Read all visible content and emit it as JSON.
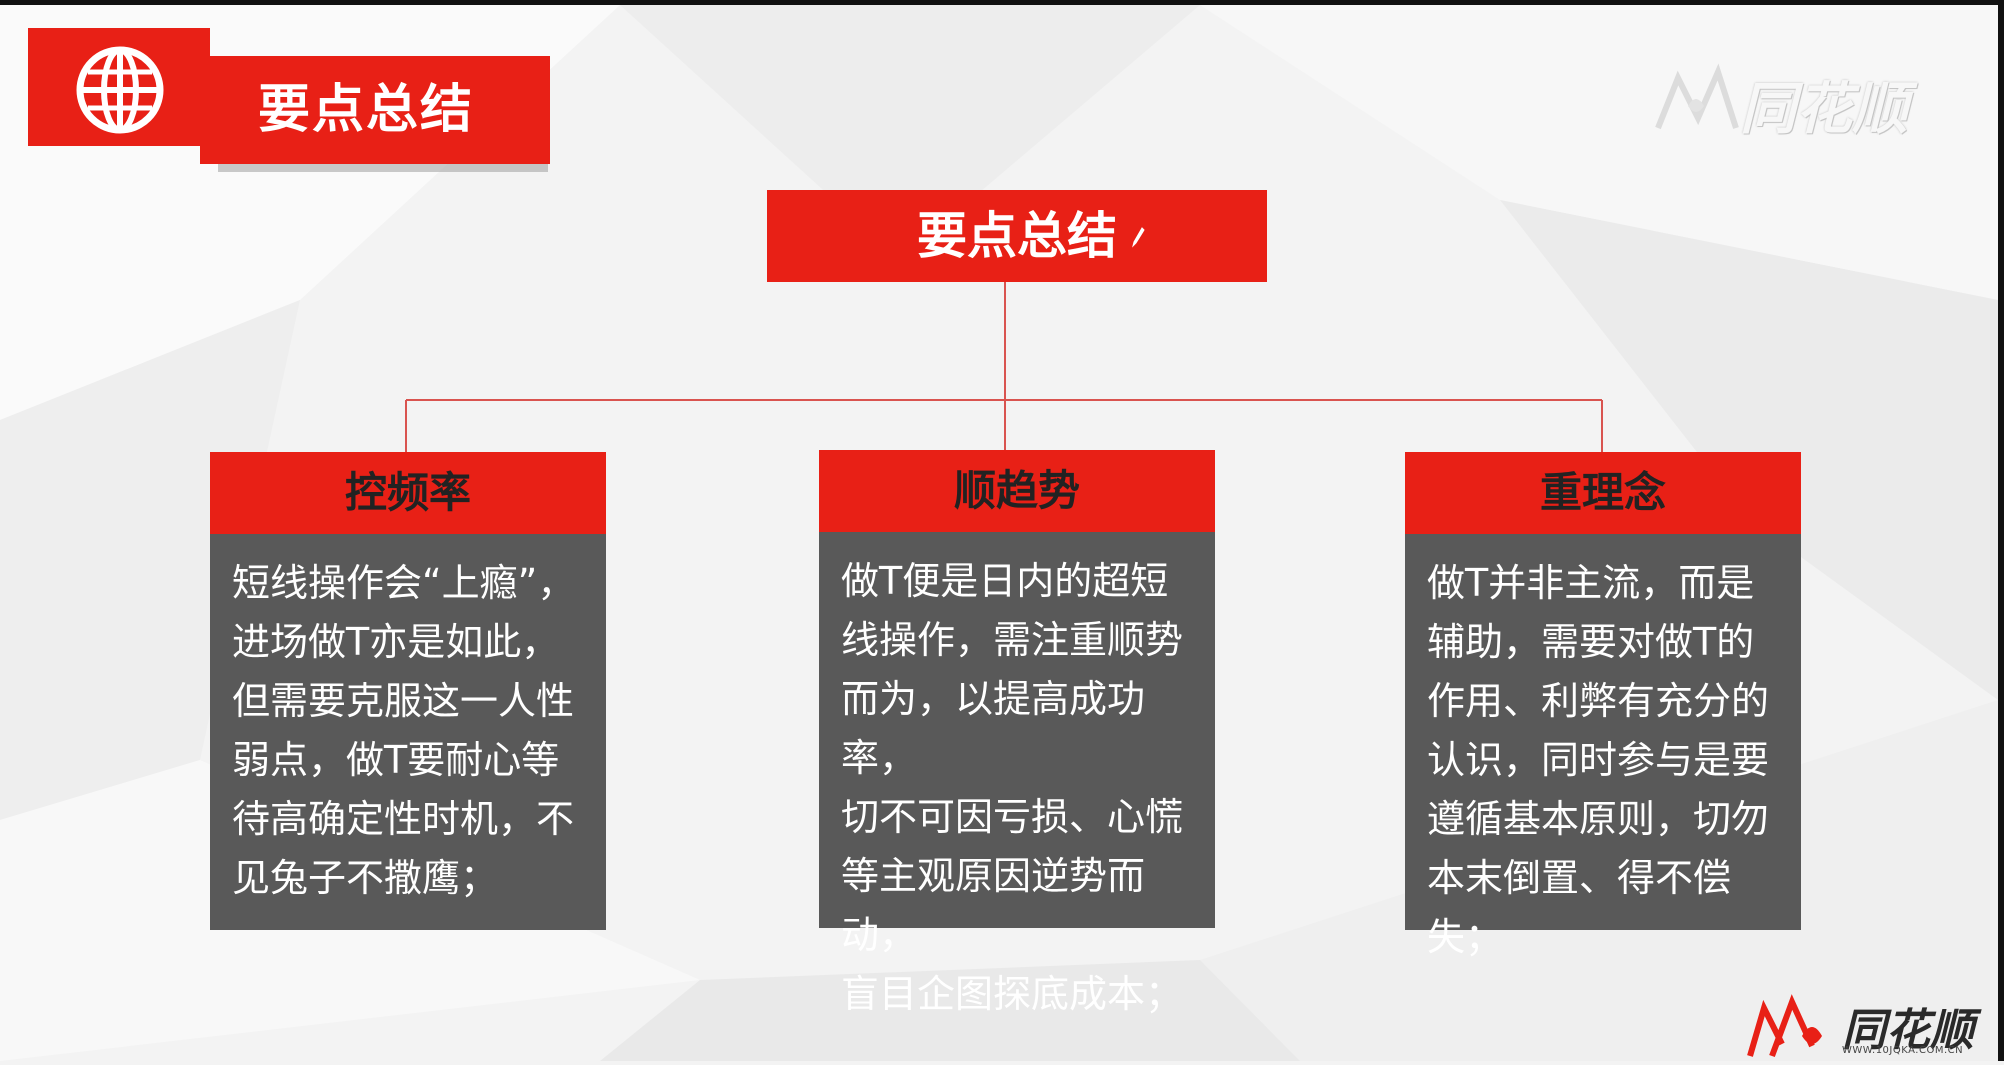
{
  "header": {
    "title": "要点总结"
  },
  "watermark": {
    "text": "同花顺"
  },
  "diagram": {
    "root": {
      "label": "要点总结"
    },
    "nodes": [
      {
        "title": "控频率",
        "lines": [
          "短线操作会“上瘾”，",
          "进场做T亦是如此，",
          "但需要克服这一人性",
          "弱点，做T要耐心等",
          "待高确定性时机，不",
          "见兔子不撒鹰；"
        ]
      },
      {
        "title": "顺趋势",
        "lines": [
          "做T便是日内的超短",
          "线操作，需注重顺势",
          "而为，以提高成功率，",
          "切不可因亏损、心慌",
          "等主观原因逆势而动，",
          "盲目企图探底成本；"
        ]
      },
      {
        "title": "重理念",
        "lines": [
          "做T并非主流，而是",
          "辅助，需要对做T的",
          "作用、利弊有充分的",
          "认识，同时参与是要",
          "遵循基本原则，切勿",
          "本末倒置、得不偿失；"
        ]
      }
    ]
  },
  "brand": {
    "name": "同花顺",
    "url": "WWW.10JQKA.COM.CN"
  },
  "colors": {
    "accent": "#e82016",
    "card_body": "#595959",
    "background": "#f3f3f3"
  }
}
